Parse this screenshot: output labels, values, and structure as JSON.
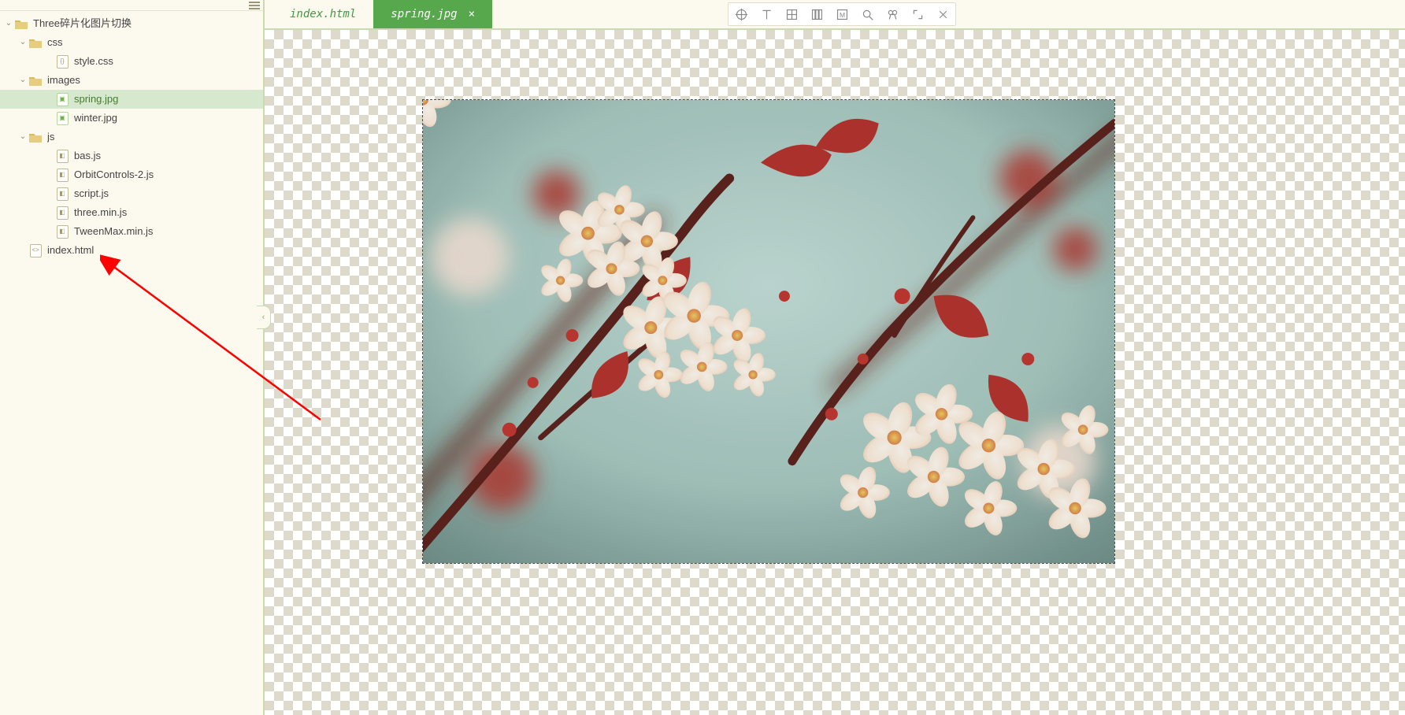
{
  "sidebar": {
    "root_label": "Three碎片化图片切换",
    "tree": [
      {
        "depth": 0,
        "type": "folder",
        "expanded": true,
        "label": "Three碎片化图片切换",
        "selected": false
      },
      {
        "depth": 1,
        "type": "folder",
        "expanded": true,
        "label": "css",
        "selected": false
      },
      {
        "depth": 2,
        "type": "css",
        "expanded": null,
        "label": "style.css",
        "selected": false
      },
      {
        "depth": 1,
        "type": "folder",
        "expanded": true,
        "label": "images",
        "selected": false
      },
      {
        "depth": 2,
        "type": "image",
        "expanded": null,
        "label": "spring.jpg",
        "selected": true
      },
      {
        "depth": 2,
        "type": "image",
        "expanded": null,
        "label": "winter.jpg",
        "selected": false
      },
      {
        "depth": 1,
        "type": "folder",
        "expanded": true,
        "label": "js",
        "selected": false
      },
      {
        "depth": 2,
        "type": "js",
        "expanded": null,
        "label": "bas.js",
        "selected": false
      },
      {
        "depth": 2,
        "type": "js",
        "expanded": null,
        "label": "OrbitControls-2.js",
        "selected": false
      },
      {
        "depth": 2,
        "type": "js",
        "expanded": null,
        "label": "script.js",
        "selected": false
      },
      {
        "depth": 2,
        "type": "js",
        "expanded": null,
        "label": "three.min.js",
        "selected": false
      },
      {
        "depth": 2,
        "type": "js",
        "expanded": null,
        "label": "TweenMax.min.js",
        "selected": false
      },
      {
        "depth": 1,
        "type": "html",
        "expanded": null,
        "label": "index.html",
        "selected": false
      }
    ]
  },
  "tabs": [
    {
      "label": "index.html",
      "active": false
    },
    {
      "label": "spring.jpg",
      "active": true
    }
  ],
  "toolbar": {
    "items": [
      "center-icon",
      "text-tool-icon",
      "grid-icon",
      "columns-icon",
      "em-box-icon",
      "zoom-icon",
      "crop-icon",
      "expand-icon",
      "close-icon"
    ]
  },
  "colors": {
    "accent": "#57a84d",
    "sidebar_bg": "#fcf9ee",
    "border": "#cadab3",
    "selected_bg": "#d6e8cd"
  }
}
